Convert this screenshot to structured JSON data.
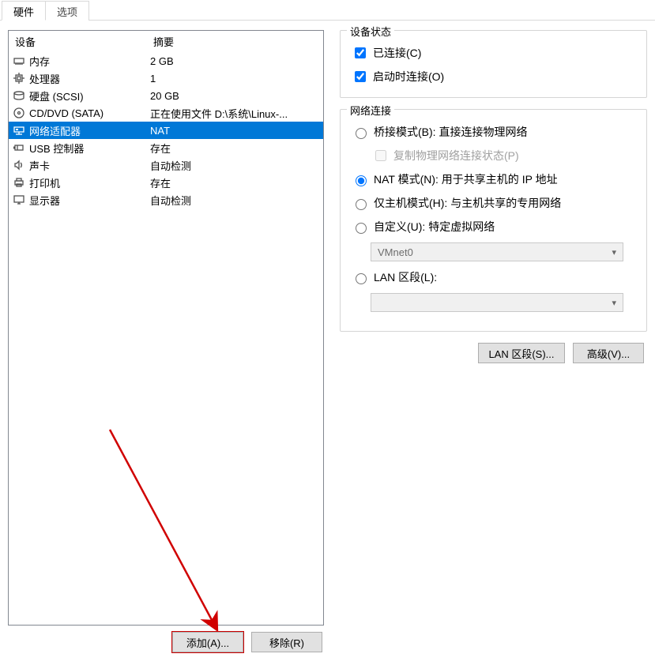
{
  "tabs": {
    "hardware": "硬件",
    "options": "选项"
  },
  "device_list": {
    "header_device": "设备",
    "header_summary": "摘要",
    "rows": [
      {
        "icon": "memory-icon",
        "label": "内存",
        "summary": "2 GB"
      },
      {
        "icon": "cpu-icon",
        "label": "处理器",
        "summary": "1"
      },
      {
        "icon": "disk-icon",
        "label": "硬盘 (SCSI)",
        "summary": "20 GB"
      },
      {
        "icon": "cd-icon",
        "label": "CD/DVD (SATA)",
        "summary": "正在使用文件 D:\\系统\\Linux-..."
      },
      {
        "icon": "network-icon",
        "label": "网络适配器",
        "summary": "NAT"
      },
      {
        "icon": "usb-icon",
        "label": "USB 控制器",
        "summary": "存在"
      },
      {
        "icon": "sound-icon",
        "label": "声卡",
        "summary": "自动检测"
      },
      {
        "icon": "printer-icon",
        "label": "打印机",
        "summary": "存在"
      },
      {
        "icon": "display-icon",
        "label": "显示器",
        "summary": "自动检测"
      }
    ]
  },
  "buttons": {
    "add": "添加(A)...",
    "remove": "移除(R)",
    "lan_segments": "LAN 区段(S)...",
    "advanced": "高级(V)..."
  },
  "device_status": {
    "legend": "设备状态",
    "connected": "已连接(C)",
    "connect_on_start": "启动时连接(O)"
  },
  "network": {
    "legend": "网络连接",
    "bridged": "桥接模式(B): 直接连接物理网络",
    "replicate": "复制物理网络连接状态(P)",
    "nat": "NAT 模式(N): 用于共享主机的 IP 地址",
    "hostonly": "仅主机模式(H): 与主机共享的专用网络",
    "custom": "自定义(U): 特定虚拟网络",
    "custom_value": "VMnet0",
    "lan_segment": "LAN 区段(L):",
    "lan_value": ""
  },
  "selected_index": 4
}
